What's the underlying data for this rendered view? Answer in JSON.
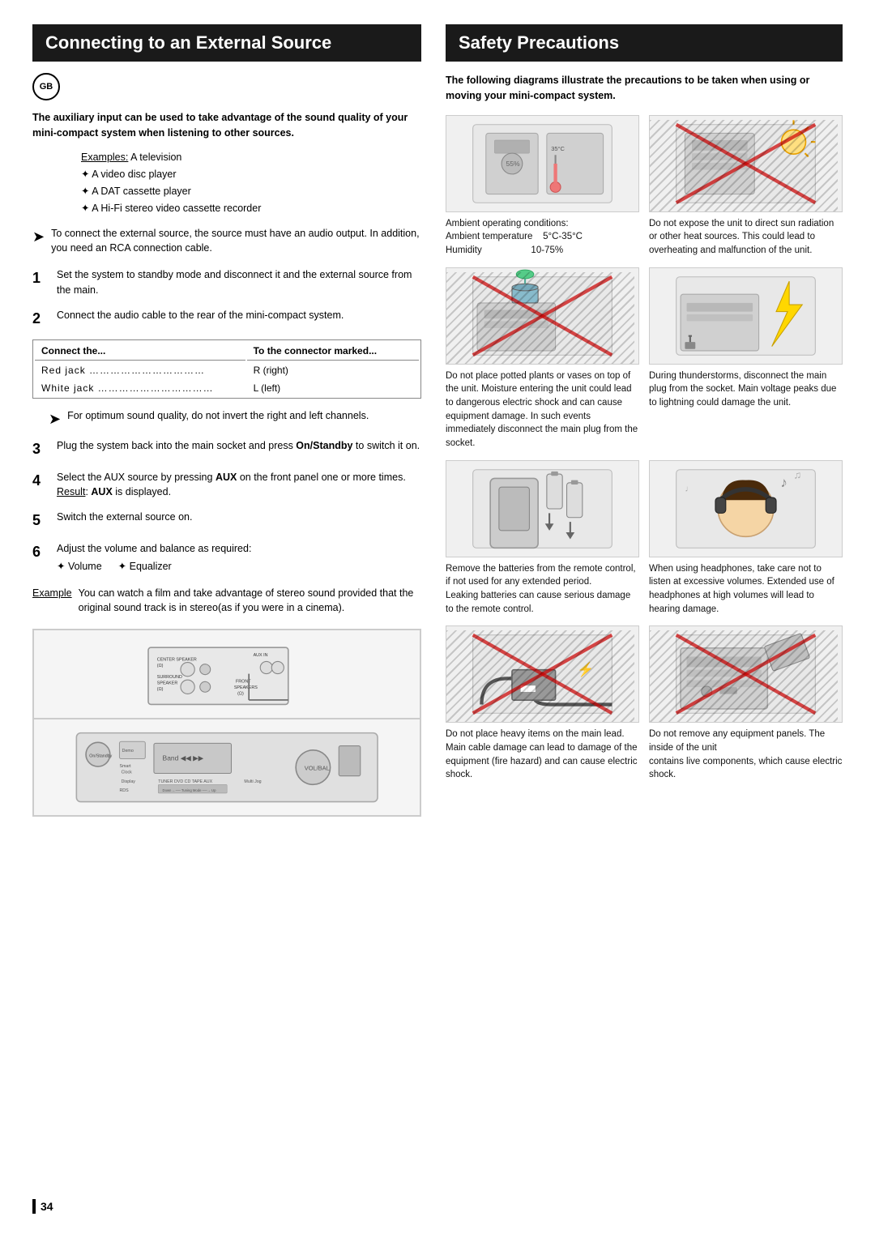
{
  "left": {
    "title": "Connecting to an External Source",
    "gb_label": "GB",
    "intro": {
      "text": "The auxiliary input can be used to take advantage of the sound quality of your mini-compact system when listening to other sources.",
      "examples_label": "Examples:",
      "examples": [
        "A television",
        "A video disc player",
        "A DAT cassette player",
        "A Hi-Fi stereo video cassette recorder"
      ]
    },
    "note1": "To connect the external source, the source must have an audio output. In addition, you need an RCA connection cable.",
    "steps": [
      {
        "num": "1",
        "text": "Set the system to standby mode and disconnect it and the external source from the main."
      },
      {
        "num": "2",
        "text": "Connect the audio cable to the rear of the mini-compact system."
      }
    ],
    "connector_table": {
      "col1_header": "Connect the...",
      "col2_header": "To the connector marked...",
      "rows": [
        {
          "col1": "Red jack ……………………………",
          "col2": "R (right)"
        },
        {
          "col1": "White jack ……………………………",
          "col2": "L (left)"
        }
      ]
    },
    "note2": "For optimum sound quality, do not invert the right and left channels.",
    "steps2": [
      {
        "num": "3",
        "text": "Plug the system back into the main socket and press On/Standby to switch it on."
      },
      {
        "num": "4",
        "text": "Select the AUX source by pressing AUX on the front panel one or more times.",
        "result": "AUX is displayed."
      },
      {
        "num": "5",
        "text": "Switch the external source on."
      },
      {
        "num": "6",
        "text": "Adjust the volume and balance as required:",
        "vol": "Volume",
        "eq": "Equalizer"
      }
    ],
    "example": {
      "label": "Example",
      "text": "You can watch a film and take advantage of stereo sound provided that the original sound track is in stereo(as if you were in a cinema)."
    },
    "page_number": "34"
  },
  "right": {
    "title": "Safety Precautions",
    "intro": "The following diagrams illustrate the precautions to be taken when using or moving your mini-compact system.",
    "items": [
      {
        "id": "ambient",
        "has_cross": false,
        "caption": "Ambient operating conditions:\nAmbient temperature    5°C-35°C\nHumidity                          10-75%"
      },
      {
        "id": "no-direct-sun",
        "has_cross": true,
        "caption": "Do not expose the unit to direct sun radiation or other heat sources. This could lead to overheating and malfunction of the unit."
      },
      {
        "id": "no-plants",
        "has_cross": true,
        "caption": "Do not place potted plants or vases on top of the unit. Moisture entering the unit could lead to dangerous electric shock and can cause equipment damage. In such events immediately disconnect the main plug from the socket."
      },
      {
        "id": "thunderstorm",
        "has_cross": false,
        "caption": "During thunderstorms, disconnect the main plug from the socket. Main voltage peaks due to lightning could damage the unit."
      },
      {
        "id": "batteries",
        "has_cross": false,
        "caption": "Remove the batteries from the remote control, if not used for any extended period.\nLeaking batteries can cause serious damage to the remote control."
      },
      {
        "id": "headphones",
        "has_cross": false,
        "caption": "When using headphones, take care not to listen at excessive volumes. Extended use of headphones at high volumes will lead to hearing damage."
      },
      {
        "id": "no-heavy",
        "has_cross": true,
        "caption": "Do not place heavy items on the main lead. Main cable damage can lead to damage of the equipment (fire hazard) and can cause electric shock."
      },
      {
        "id": "no-panels",
        "has_cross": true,
        "caption": "Do not remove any equipment panels. The inside of the unit\ncontains live components, which cause electric shock."
      }
    ]
  }
}
